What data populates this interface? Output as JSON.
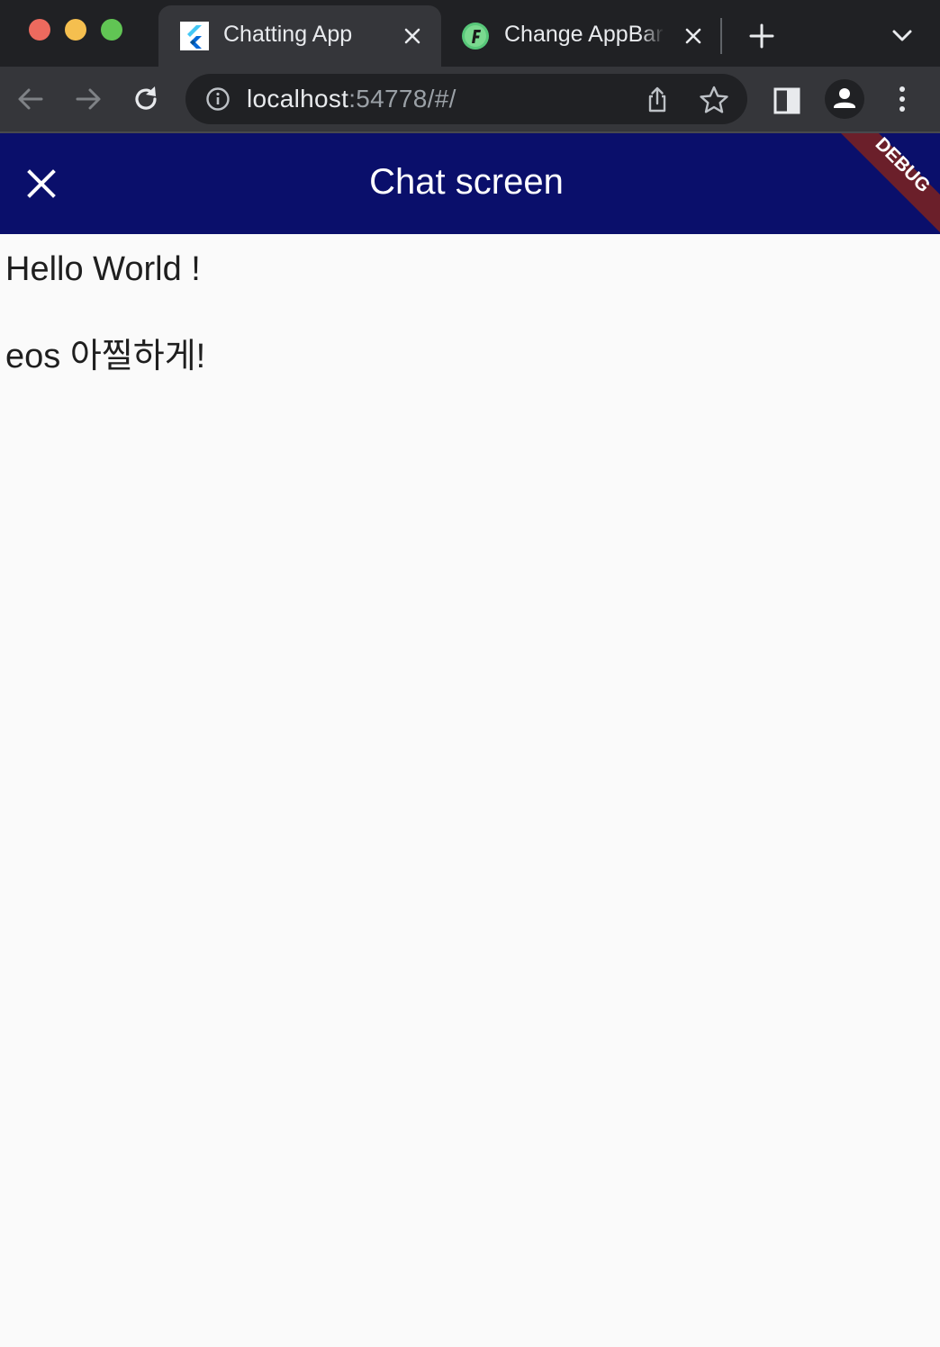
{
  "browser": {
    "tabs": [
      {
        "title": "Chatting App",
        "favicon": "flutter-icon",
        "active": true
      },
      {
        "title": "Change AppBar",
        "favicon": "flutterflow-icon",
        "active": false
      }
    ],
    "address": {
      "host": "localhost",
      "rest": ":54778/#/"
    }
  },
  "app": {
    "appbar": {
      "title": "Chat screen",
      "leading_icon": "close-icon",
      "color": "#0a0f6b"
    },
    "debug_banner": "DEBUG",
    "messages": [
      "Hello World !",
      "eos 아찔하게!"
    ]
  },
  "colors": {
    "tabstrip": "#202124",
    "toolbar": "#35363a",
    "debug_banner": "#6b1f2a",
    "background": "#fafafa"
  }
}
